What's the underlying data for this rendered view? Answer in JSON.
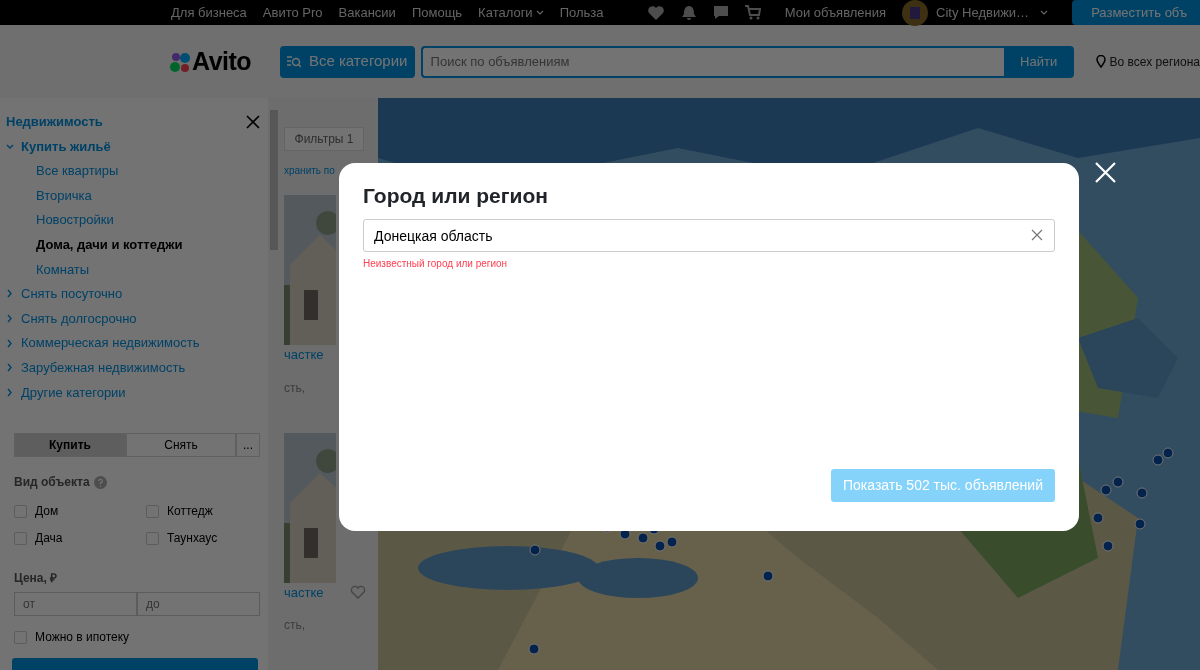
{
  "topbar": {
    "links": [
      {
        "label": "Для бизнеса",
        "dropdown": false
      },
      {
        "label": "Авито Pro",
        "dropdown": false
      },
      {
        "label": "Вакансии",
        "dropdown": false
      },
      {
        "label": "Помощь",
        "dropdown": false
      },
      {
        "label": "Каталоги",
        "dropdown": true
      },
      {
        "label": "Польза",
        "dropdown": false
      }
    ],
    "my_ads": "Мои объявления",
    "user": "City Недвижи…",
    "post_button": "Разместить объ"
  },
  "header": {
    "logo": "Avito",
    "categories_button": "Все категории",
    "search": {
      "placeholder": "Поиск по объявлениям"
    },
    "search_button": "Найти",
    "region": "Во всех региона"
  },
  "sidebar": {
    "title": "Недвижимость",
    "tree": [
      {
        "label": "Купить жильё",
        "expanded": true,
        "children": [
          {
            "label": "Все квартиры",
            "selected": false
          },
          {
            "label": "Вторичка",
            "selected": false
          },
          {
            "label": "Новостройки",
            "selected": false
          },
          {
            "label": "Дома, дачи и коттеджи",
            "selected": true
          },
          {
            "label": "Комнаты",
            "selected": false
          }
        ]
      },
      {
        "label": "Снять посуточно",
        "expanded": false
      },
      {
        "label": "Снять долгосрочно",
        "expanded": false
      },
      {
        "label": "Коммерческая недвижимость",
        "expanded": false
      },
      {
        "label": "Зарубежная недвижимость",
        "expanded": false
      },
      {
        "label": "Другие категории",
        "expanded": false
      }
    ],
    "deal_tabs": [
      {
        "label": "Купить",
        "selected": true
      },
      {
        "label": "Снять",
        "selected": false
      },
      {
        "label": "...",
        "selected": false
      }
    ],
    "object_type_label": "Вид объекта",
    "object_types": [
      {
        "label": "Дом",
        "checked": false
      },
      {
        "label": "Коттедж",
        "checked": false
      },
      {
        "label": "Дача",
        "checked": false
      },
      {
        "label": "Таунхаус",
        "checked": false
      }
    ],
    "price_label": "Цена, ₽",
    "price_from": {
      "placeholder": "от"
    },
    "price_to": {
      "placeholder": "до"
    },
    "mortgage": {
      "label": "Можно в ипотеку",
      "checked": false
    }
  },
  "listing": {
    "filter_button": "Фильтры 1",
    "save_link": "хранить по",
    "cards": [
      {
        "title": "частке",
        "address": "сть,"
      },
      {
        "title": "частке",
        "address": "сть,"
      }
    ]
  },
  "modal": {
    "title": "Город или регион",
    "input": {
      "value": "Донецкая область"
    },
    "error": "Неизвестный город или регион",
    "show_button": {
      "label": "Показать 502 тыс. объявлений",
      "disabled": true
    }
  }
}
